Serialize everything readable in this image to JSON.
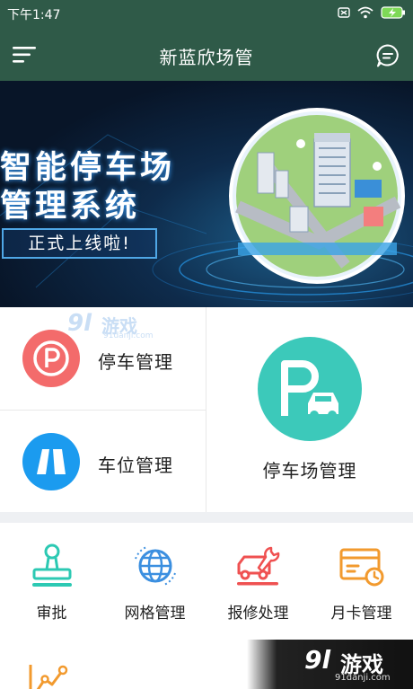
{
  "status_bar": {
    "time": "下午1:47"
  },
  "app_bar": {
    "title": "新蓝欣场管"
  },
  "banner": {
    "line1": "智能停车场",
    "line2": "管理系统",
    "tag": "正式上线啦!"
  },
  "grid": {
    "parking": {
      "label": "停车管理"
    },
    "space": {
      "label": "车位管理"
    },
    "lot": {
      "label": "停车场管理"
    }
  },
  "features": [
    {
      "label": "审批"
    },
    {
      "label": "网格管理"
    },
    {
      "label": "报修处理"
    },
    {
      "label": "月卡管理"
    }
  ],
  "watermark": {
    "num": "9l",
    "text": "游戏",
    "site": "91danji.com"
  },
  "colors": {
    "header": "#2f5a48",
    "parking_icon": "#f36b6b",
    "space_icon": "#1b9bef",
    "lot_icon": "#3cc9ba",
    "approval_icon": "#2cc9b3",
    "grid_icon": "#3b8fe0",
    "repair_icon": "#ef5151",
    "card_icon": "#f29a2e"
  }
}
